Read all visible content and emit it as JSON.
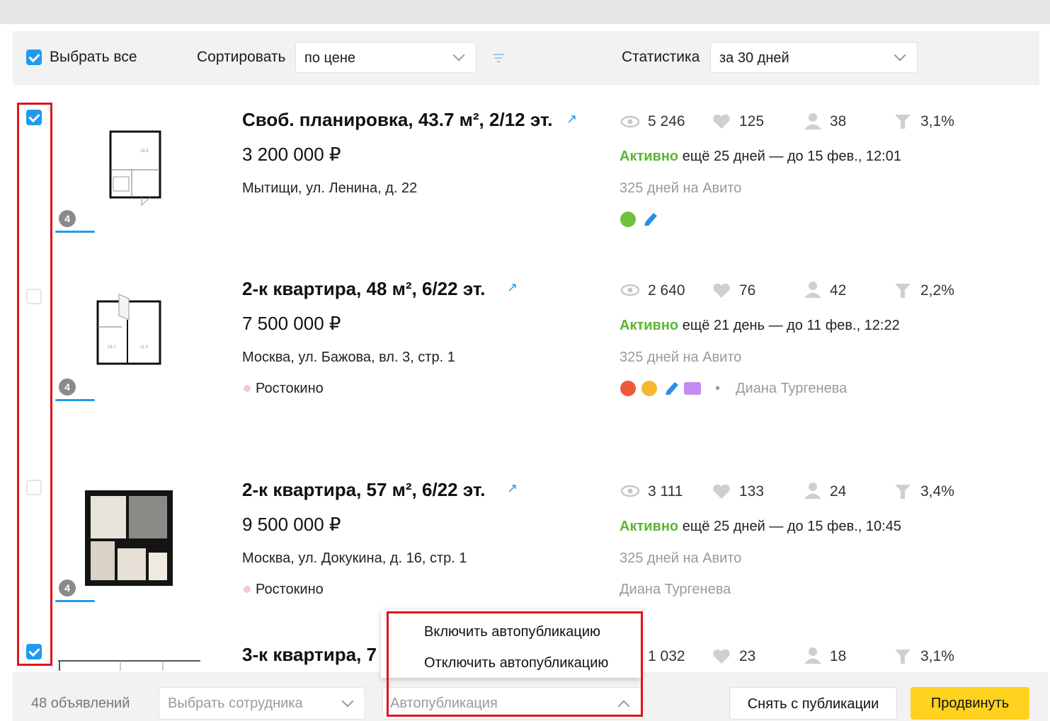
{
  "toolbar": {
    "select_all": "Выбрать все",
    "sort_label": "Сортировать",
    "sort_value": "по цене",
    "stats_label": "Статистика",
    "stats_value": "за 30 дней"
  },
  "listings": [
    {
      "title": "Своб. планировка, 43.7 м², 2/12 эт.",
      "price": "3 200 000 ₽",
      "address": "Мытищи, ул. Ленина, д. 22",
      "metro": "",
      "views": "5 246",
      "favorites": "125",
      "contacts": "38",
      "conversion": "3,1%",
      "status": "Активно",
      "status_rest": "ещё 25 дней — до 15 фев., 12:01",
      "days": "325 дней на Авито",
      "employee": "",
      "photo_count": "4",
      "checked": true
    },
    {
      "title": "2-к квартира, 48 м², 6/22 эт.",
      "price": "7 500 000 ₽",
      "address": "Москва, ул. Бажова, вл. 3, стр. 1",
      "metro": "Ростокино",
      "views": "2 640",
      "favorites": "76",
      "contacts": "42",
      "conversion": "2,2%",
      "status": "Активно",
      "status_rest": "ещё 21 день — до 11 фев., 12:22",
      "days": "325 дней на Авито",
      "employee": "Диана Тургенева",
      "photo_count": "4",
      "checked": false
    },
    {
      "title": "2-к квартира, 57 м², 6/22 эт.",
      "price": "9 500 000 ₽",
      "address": "Москва, ул. Докукина, д. 16, стр. 1",
      "metro": "Ростокино",
      "views": "3 111",
      "favorites": "133",
      "contacts": "24",
      "conversion": "3,4%",
      "status": "Активно",
      "status_rest": "ещё 25 дней — до 15 фев., 10:45",
      "days": "325 дней на Авито",
      "employee": "Диана Тургенева",
      "photo_count": "4",
      "checked": false
    },
    {
      "title": "3-к квартира, 7",
      "views": "1 032",
      "favorites": "23",
      "contacts": "18",
      "conversion": "3,1%",
      "checked": true
    }
  ],
  "promo_icons": {
    "row1": [
      "x10-icon",
      "highlight-icon"
    ],
    "row2": [
      "rocket-icon",
      "star-icon",
      "highlight-icon",
      "xl-icon"
    ]
  },
  "dropdown_menu": {
    "items": [
      "Включить автопубликацию",
      "Отключить автопубликацию"
    ]
  },
  "bottom_bar": {
    "count": "48 объявлений",
    "employee_placeholder": "Выбрать сотрудника",
    "autopublish_placeholder": "Автопубликация",
    "unpublish_button": "Снять с публикации",
    "promote_button": "Продвинуть"
  },
  "colors": {
    "accent_blue": "#1e9bf0",
    "active_green": "#5cb533",
    "promote_yellow": "#ffd21f",
    "highlight_red": "#e0141e"
  }
}
